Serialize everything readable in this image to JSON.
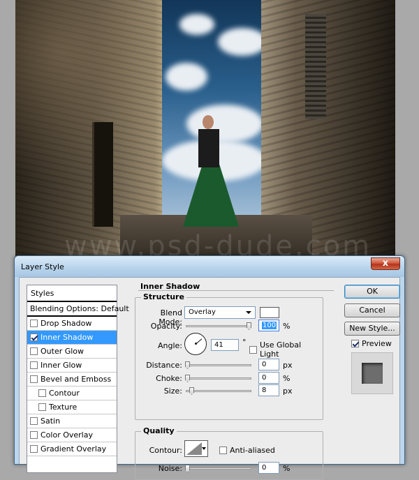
{
  "photo": {
    "watermark": "www.psd-dude.com"
  },
  "dialog": {
    "title": "Layer Style",
    "close_glyph": "x",
    "styles_header": "Styles",
    "blending": "Blending Options: Default",
    "items": [
      {
        "label": "Drop Shadow",
        "checked": false
      },
      {
        "label": "Inner Shadow",
        "checked": true,
        "selected": true
      },
      {
        "label": "Outer Glow",
        "checked": false
      },
      {
        "label": "Inner Glow",
        "checked": false
      },
      {
        "label": "Bevel and Emboss",
        "checked": false
      },
      {
        "label": "Contour",
        "checked": false,
        "indent": true
      },
      {
        "label": "Texture",
        "checked": false,
        "indent": true
      },
      {
        "label": "Satin",
        "checked": false
      },
      {
        "label": "Color Overlay",
        "checked": false
      },
      {
        "label": "Gradient Overlay",
        "checked": false
      }
    ],
    "panel_title": "Inner Shadow",
    "structure": {
      "title": "Structure",
      "blend_mode_label": "Blend Mode:",
      "blend_mode_value": "Overlay",
      "blend_color": "#ffffff",
      "opacity_label": "Opacity:",
      "opacity_value": "100",
      "opacity_unit": "%",
      "angle_label": "Angle:",
      "angle_value": "41",
      "angle_unit": "°",
      "global_light_label": "Use Global Light",
      "distance_label": "Distance:",
      "distance_value": "0",
      "distance_unit": "px",
      "choke_label": "Choke:",
      "choke_value": "0",
      "choke_unit": "%",
      "size_label": "Size:",
      "size_value": "8",
      "size_unit": "px"
    },
    "quality": {
      "title": "Quality",
      "contour_label": "Contour:",
      "anti_aliased_label": "Anti-aliased",
      "noise_label": "Noise:",
      "noise_value": "0",
      "noise_unit": "%"
    },
    "buttons": {
      "ok": "OK",
      "cancel": "Cancel",
      "new_style": "New Style...",
      "preview": "Preview"
    }
  }
}
